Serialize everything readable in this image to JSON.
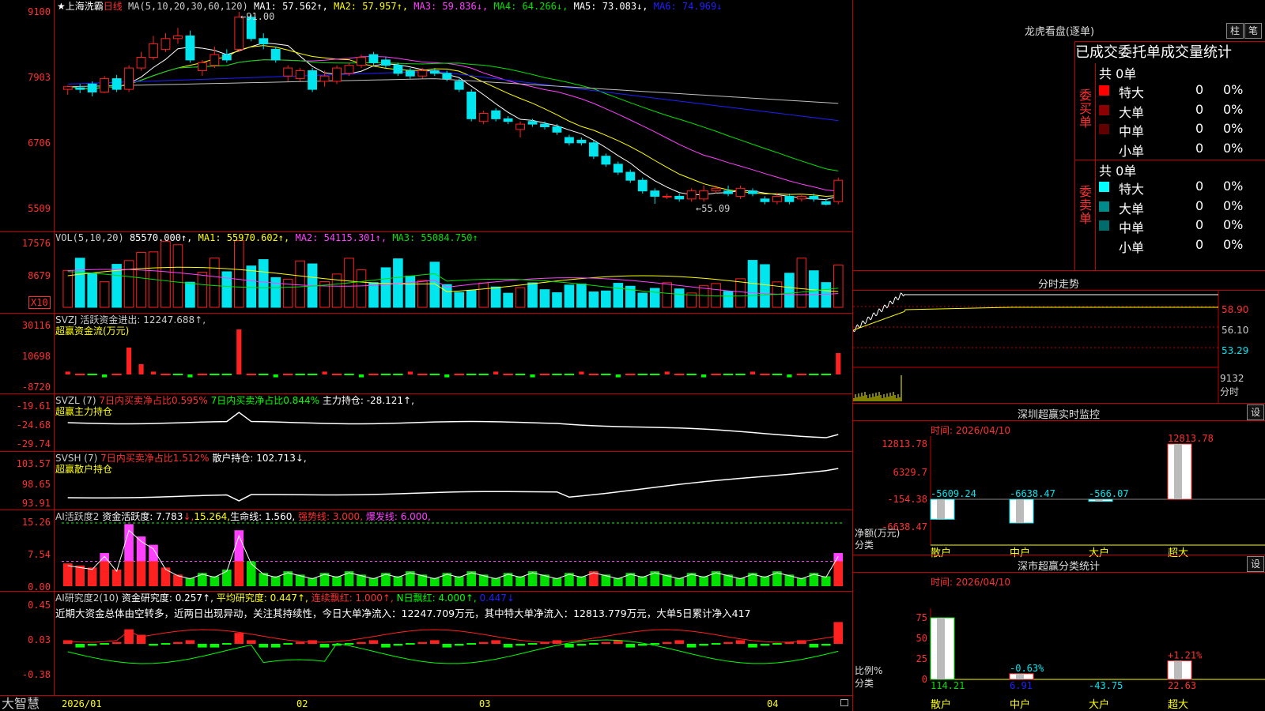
{
  "colors": {
    "up": "#ff2020",
    "down": "#00e5ee",
    "ma1": "#ffffff",
    "ma2": "#ffff00",
    "ma3": "#ff40ff",
    "ma4": "#00e000",
    "ma5": "#2020ff",
    "ma6": "#c0c0c0",
    "green": "#00ff00"
  },
  "main": {
    "title": "★上海洗霸",
    "period": "日线",
    "ma_header": "MA(5,10,20,30,60,120)",
    "ma": [
      {
        "label": "MA1: 57.562↑,",
        "color": "#ffffff"
      },
      {
        "label": "MA2: 57.957↑,",
        "color": "#ffff00"
      },
      {
        "label": "MA3: 59.836↓,",
        "color": "#ff40ff"
      },
      {
        "label": "MA4: 64.266↓,",
        "color": "#00e000"
      },
      {
        "label": "MA5: 73.083↓,",
        "color": "#ffffff"
      },
      {
        "label": "MA6: 74.969↓",
        "color": "#2020ff"
      }
    ],
    "y_labels": [
      "9100",
      "7903",
      "6706",
      "5509"
    ],
    "high_note": "91.00",
    "low_note": "55.09"
  },
  "vol": {
    "header": "VOL(5,10,20)",
    "value": "85570.000↑,",
    "ma1": "MA1: 55970.602↑,",
    "ma2": "MA2: 54115.301↑,",
    "ma3": "MA3: 55084.750↑",
    "y_labels": [
      "17576",
      "8679"
    ],
    "unit": "X10"
  },
  "svzj": {
    "header": "SVZJ  活跃资金进出: 12247.688↑,",
    "sub": "超赢资金流(万元)",
    "y_labels": [
      "30116",
      "10698",
      "-8720"
    ]
  },
  "svzl": {
    "header": "SVZL (7)",
    "p1": "7日内买卖净占比0.595%",
    "p2": "7日内买卖净占比0.844%",
    "p3": "主力持仓: -28.121↑,",
    "sub": "超赢主力持仓",
    "y_labels": [
      "-19.61",
      "-24.68",
      "-29.74"
    ]
  },
  "svsh": {
    "header": "SVSH (7)",
    "p1": "7日内买卖净占比1.512%",
    "p2": "散户持仓: 102.713↓,",
    "sub": "超赢散户持仓",
    "y_labels": [
      "103.57",
      "98.65",
      "93.91"
    ]
  },
  "ai1": {
    "header": "AI活跃度2",
    "p1": "资金活跃度: 7.783",
    "p2": "↓,",
    "p3": "15.264,",
    "p4": "生命线: 1.560,",
    "p5": "强势线: 3.000,",
    "p6": "爆发线: 6.000,",
    "y_labels": [
      "15.26",
      "7.54",
      "0.00"
    ]
  },
  "ai2": {
    "header": "AI研究度2(10)",
    "p1": "资金研究度: 0.257↑,",
    "p2": "平均研究度: 0.447↑,",
    "p3": "连续飘红: 1.000↑,",
    "p4": "N日飘红: 4.000↑,",
    "p5": "0.447↓",
    "text": "近期大资金总体由空转多，近两日出现异动，关注其持续性，今日大单净流入：12247.709万元，其中特大单净流入：12813.779万元，大单5日累计净入417",
    "y_labels": [
      "0.45",
      "0.03",
      "-0.38"
    ]
  },
  "xaxis": {
    "brand": "大智慧",
    "dates": [
      "2026/01",
      "02",
      "03",
      "04"
    ]
  },
  "right": {
    "dragon": {
      "title": "龙虎看盘(逐单)",
      "btn1": "柱",
      "btn2": "笔",
      "stat_title": "已成交委托单成交量统计",
      "buy_label": "委买单",
      "sell_label": "委卖单",
      "buy_total": "共 0单",
      "sell_total": "共 0单",
      "buy_rows": [
        {
          "name": "特大",
          "v": "0",
          "p": "0%",
          "c": "#ff0000"
        },
        {
          "name": "大单",
          "v": "0",
          "p": "0%",
          "c": "#8b0000"
        },
        {
          "name": "中单",
          "v": "0",
          "p": "0%",
          "c": "#600000"
        },
        {
          "name": "小单",
          "v": "0",
          "p": "0%",
          "c": ""
        }
      ],
      "sell_rows": [
        {
          "name": "特大",
          "v": "0",
          "p": "0%",
          "c": "#00ffff"
        },
        {
          "name": "大单",
          "v": "0",
          "p": "0%",
          "c": "#008b8b"
        },
        {
          "name": "中单",
          "v": "0",
          "p": "0%",
          "c": "#006b6b"
        },
        {
          "name": "小单",
          "v": "0",
          "p": "0%",
          "c": ""
        }
      ]
    },
    "minute": {
      "title": "分时走势",
      "y_labels": [
        "58.90",
        "56.10",
        "53.29"
      ],
      "vol_label": "9132",
      "vol_unit": "分时"
    },
    "monitor": {
      "title": "深圳超赢实时监控",
      "btn": "设",
      "time": "时间: 2026/04/10",
      "y_labels": [
        "12813.78",
        "6329.7",
        "-154.38",
        "-6638.47"
      ],
      "unit1": "净额(万元)",
      "unit2": "分类",
      "bars": [
        {
          "cat": "散户",
          "v": -5609.24,
          "label": "-5609.24"
        },
        {
          "cat": "中户",
          "v": -6638.47,
          "label": "-6638.47"
        },
        {
          "cat": "大户",
          "v": -566.07,
          "label": "-566.07"
        },
        {
          "cat": "超大",
          "v": 12813.78,
          "label": "12813.78"
        }
      ]
    },
    "classify": {
      "title": "深市超赢分类统计",
      "btn": "设",
      "time": "时间: 2026/04/10",
      "y_labels": [
        "75",
        "50",
        "25",
        "0"
      ],
      "unit1": "比例%",
      "unit2": "分类",
      "bars": [
        {
          "cat": "散户",
          "v": 114.21,
          "label": "114.21",
          "top": ""
        },
        {
          "cat": "中户",
          "v": 6.91,
          "label": "6.91",
          "top": "-0.63%"
        },
        {
          "cat": "大户",
          "v": -43.75,
          "label": "-43.75",
          "top": ""
        },
        {
          "cat": "超大",
          "v": 22.63,
          "label": "22.63",
          "top": "+1.21%"
        }
      ]
    }
  },
  "chart_data": {
    "type": "candlestick",
    "x": [
      "2026/01",
      "02",
      "03",
      "04"
    ],
    "ylim": [
      55.09,
      91.0
    ],
    "candles": [
      [
        76.5,
        77.0,
        75.5,
        77.2
      ],
      [
        76.8,
        76.5,
        75.8,
        77.5
      ],
      [
        77.5,
        76.0,
        75.2,
        78.0
      ],
      [
        76.0,
        78.5,
        75.8,
        79.0
      ],
      [
        78.5,
        76.5,
        76.0,
        79.2
      ],
      [
        76.5,
        80.5,
        76.0,
        81.0
      ],
      [
        80.5,
        82.5,
        80.0,
        83.5
      ],
      [
        82.5,
        85.0,
        82.0,
        86.5
      ],
      [
        84.0,
        86.0,
        83.5,
        87.0
      ],
      [
        86.0,
        86.5,
        85.0,
        88.0
      ],
      [
        86.5,
        82.0,
        81.5,
        87.5
      ],
      [
        80.0,
        81.5,
        79.0,
        82.0
      ],
      [
        81.0,
        83.0,
        80.5,
        84.5
      ],
      [
        83.0,
        82.0,
        81.5,
        84.0
      ],
      [
        84.0,
        90.0,
        83.5,
        91.0
      ],
      [
        90.0,
        86.0,
        85.5,
        90.5
      ],
      [
        86.0,
        85.0,
        84.0,
        87.0
      ],
      [
        84.0,
        82.0,
        81.5,
        84.5
      ],
      [
        79.0,
        80.5,
        78.0,
        81.0
      ],
      [
        78.5,
        80.0,
        78.0,
        80.5
      ],
      [
        80.0,
        76.5,
        76.0,
        80.5
      ],
      [
        78.0,
        79.0,
        77.0,
        80.0
      ],
      [
        78.0,
        80.5,
        77.5,
        81.0
      ],
      [
        79.5,
        81.0,
        79.0,
        81.5
      ],
      [
        81.0,
        82.5,
        80.5,
        83.0
      ],
      [
        83.0,
        81.5,
        81.0,
        83.5
      ],
      [
        82.0,
        81.0,
        80.5,
        82.5
      ],
      [
        81.0,
        79.5,
        79.0,
        81.5
      ],
      [
        80.0,
        79.0,
        78.5,
        80.5
      ],
      [
        79.0,
        80.0,
        78.5,
        80.5
      ],
      [
        80.0,
        79.5,
        79.0,
        80.5
      ],
      [
        79.5,
        78.5,
        78.0,
        80.0
      ],
      [
        78.0,
        76.5,
        76.0,
        78.5
      ],
      [
        76.0,
        71.0,
        70.5,
        76.5
      ],
      [
        70.5,
        72.0,
        70.0,
        72.5
      ],
      [
        72.5,
        71.0,
        70.5,
        73.0
      ],
      [
        71.0,
        70.5,
        70.0,
        71.5
      ],
      [
        69.0,
        70.0,
        67.5,
        70.5
      ],
      [
        70.5,
        70.0,
        69.5,
        71.0
      ],
      [
        70.0,
        69.5,
        69.0,
        70.5
      ],
      [
        69.5,
        68.5,
        68.0,
        70.0
      ],
      [
        67.5,
        66.5,
        66.0,
        68.0
      ],
      [
        67.0,
        66.5,
        66.0,
        67.5
      ],
      [
        66.5,
        64.0,
        63.5,
        67.0
      ],
      [
        64.0,
        62.5,
        62.0,
        64.5
      ],
      [
        62.5,
        61.0,
        60.5,
        63.0
      ],
      [
        61.0,
        59.5,
        59.0,
        61.5
      ],
      [
        59.5,
        57.5,
        57.0,
        60.0
      ],
      [
        57.5,
        56.5,
        55.09,
        58.0
      ],
      [
        56.5,
        56.5,
        56.0,
        57.0
      ],
      [
        56.5,
        56.0,
        55.5,
        57.0
      ],
      [
        56.0,
        57.5,
        55.5,
        58.0
      ],
      [
        56.0,
        57.5,
        55.5,
        58.5
      ],
      [
        57.5,
        58.0,
        57.0,
        58.5
      ],
      [
        57.5,
        57.0,
        56.5,
        58.5
      ],
      [
        56.5,
        58.0,
        56.0,
        58.5
      ],
      [
        57.5,
        57.0,
        56.5,
        58.0
      ],
      [
        56.0,
        55.5,
        55.0,
        56.5
      ],
      [
        55.5,
        56.5,
        55.0,
        57.0
      ],
      [
        56.5,
        55.5,
        55.0,
        57.0
      ],
      [
        56.0,
        56.5,
        55.5,
        57.0
      ],
      [
        56.5,
        56.0,
        55.5,
        57.0
      ],
      [
        55.5,
        55.0,
        54.8,
        56.0
      ],
      [
        55.5,
        59.5,
        55.0,
        60.0
      ]
    ]
  }
}
